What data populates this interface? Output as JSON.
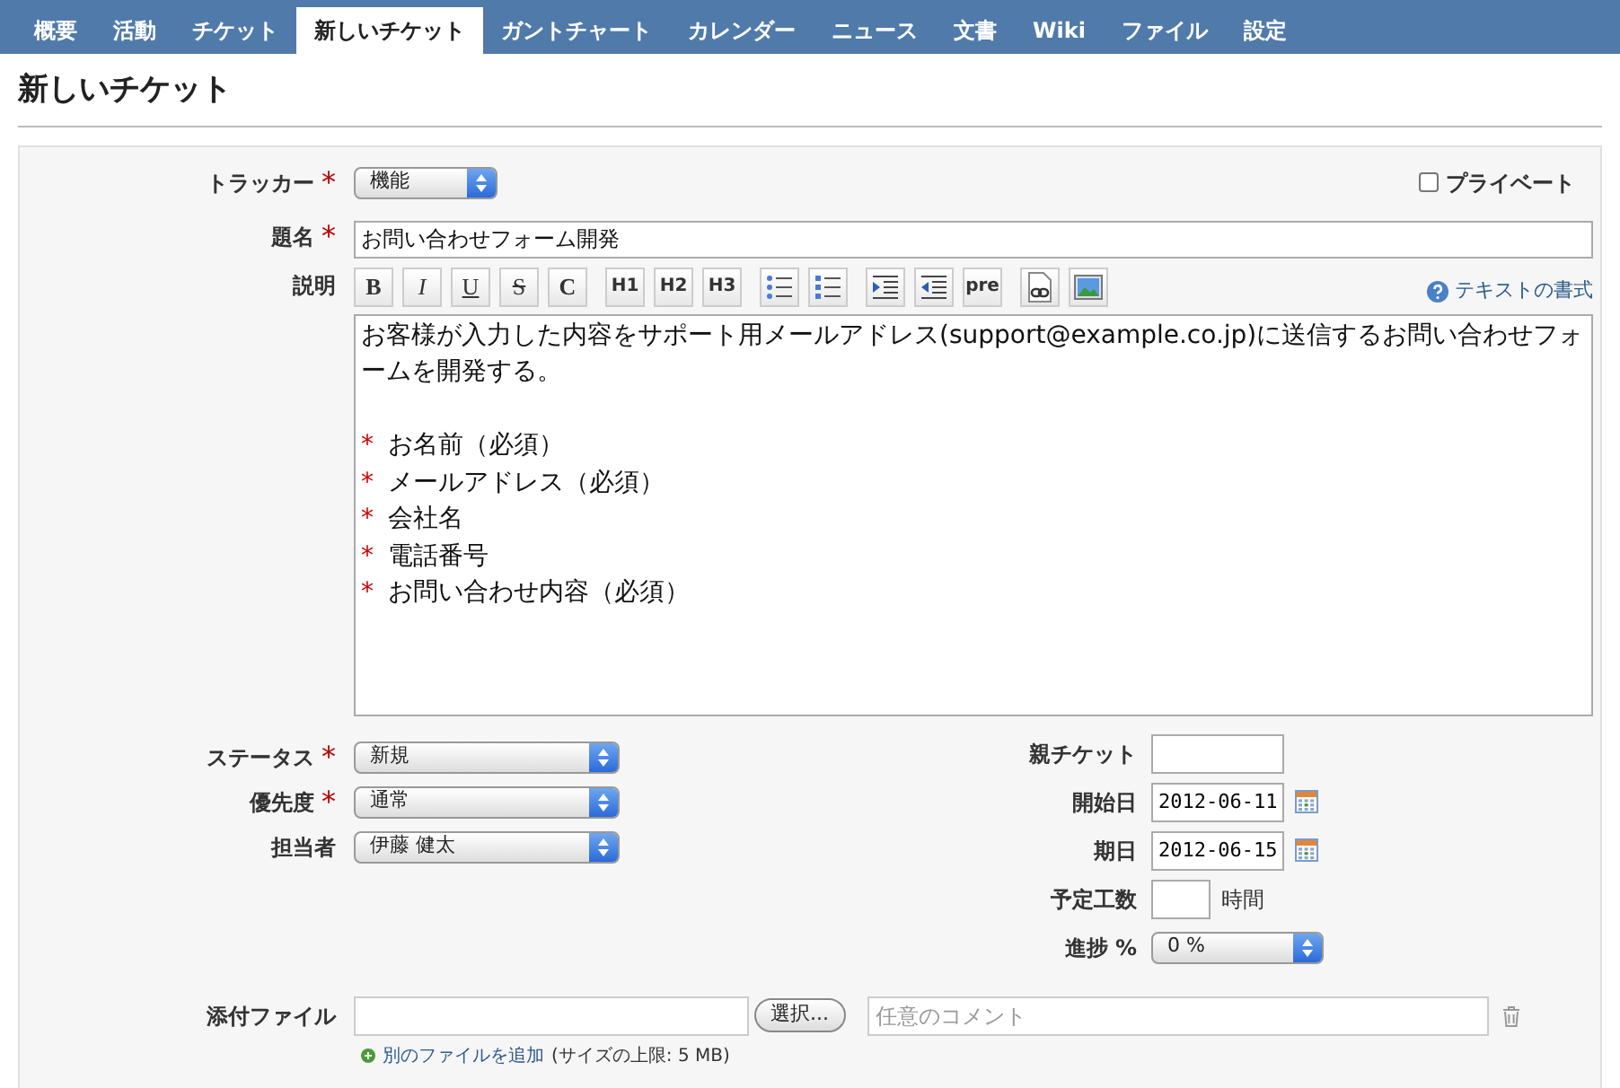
{
  "tabs": [
    {
      "label": "概要",
      "selected": false
    },
    {
      "label": "活動",
      "selected": false
    },
    {
      "label": "チケット",
      "selected": false
    },
    {
      "label": "新しいチケット",
      "selected": true
    },
    {
      "label": "ガントチャート",
      "selected": false
    },
    {
      "label": "カレンダー",
      "selected": false
    },
    {
      "label": "ニュース",
      "selected": false
    },
    {
      "label": "文書",
      "selected": false
    },
    {
      "label": "Wiki",
      "selected": false
    },
    {
      "label": "ファイル",
      "selected": false
    },
    {
      "label": "設定",
      "selected": false
    }
  ],
  "page_title": "新しいチケット",
  "tracker": {
    "label": "トラッカー",
    "required_mark": "*",
    "value": "機能"
  },
  "private": {
    "label": "プライベート",
    "checked": false
  },
  "subject": {
    "label": "題名",
    "required_mark": "*",
    "value": "お問い合わせフォーム開発"
  },
  "description": {
    "label": "説明",
    "help_link": "テキストの書式",
    "toolbar_groups": [
      [
        {
          "kind": "bold",
          "label": "B"
        },
        {
          "kind": "italic",
          "label": "I"
        },
        {
          "kind": "underline",
          "label": "U"
        },
        {
          "kind": "strike",
          "label": "S"
        },
        {
          "kind": "code",
          "label": "C"
        }
      ],
      [
        {
          "kind": "text",
          "label": "H1"
        },
        {
          "kind": "text",
          "label": "H2"
        },
        {
          "kind": "text",
          "label": "H3"
        }
      ],
      [
        {
          "kind": "ul"
        },
        {
          "kind": "ol"
        }
      ],
      [
        {
          "kind": "indent"
        },
        {
          "kind": "outdent"
        },
        {
          "kind": "text",
          "label": "pre"
        }
      ],
      [
        {
          "kind": "link"
        },
        {
          "kind": "image"
        }
      ]
    ],
    "lines": [
      {
        "kind": "paragraph",
        "text": "お客様が入力した内容をサポート用メールアドレス(support@example.co.jp)に送信するお問い合わせフォームを開発する。"
      },
      {
        "kind": "blank"
      },
      {
        "kind": "bullet",
        "bullet": "*",
        "text": "お名前（必須）"
      },
      {
        "kind": "bullet",
        "bullet": "*",
        "text": "メールアドレス（必須）"
      },
      {
        "kind": "bullet",
        "bullet": "*",
        "text": "会社名"
      },
      {
        "kind": "bullet",
        "bullet": "*",
        "text": "電話番号"
      },
      {
        "kind": "bullet",
        "bullet": "*",
        "text": "お問い合わせ内容（必須）"
      }
    ]
  },
  "left_fields": [
    {
      "label": "ステータス",
      "required_mark": "*",
      "value": "新規"
    },
    {
      "label": "優先度",
      "required_mark": "*",
      "value": "通常"
    },
    {
      "label": "担当者",
      "value": "伊藤 健太"
    }
  ],
  "right_fields": [
    {
      "kind": "input",
      "label": "親チケット"
    },
    {
      "kind": "date",
      "label": "開始日",
      "value": "2012-06-11"
    },
    {
      "kind": "date",
      "label": "期日",
      "value": "2012-06-15"
    },
    {
      "kind": "hours",
      "label": "予定工数",
      "unit": "時間"
    },
    {
      "kind": "select",
      "label": "進捗 %",
      "value": "0 %"
    }
  ],
  "attachment": {
    "label": "添付ファイル",
    "browse": "選択...",
    "comment_placeholder": "任意のコメント",
    "add_link": "別のファイルを追加",
    "size_note": "(サイズの上限: 5 MB)"
  }
}
